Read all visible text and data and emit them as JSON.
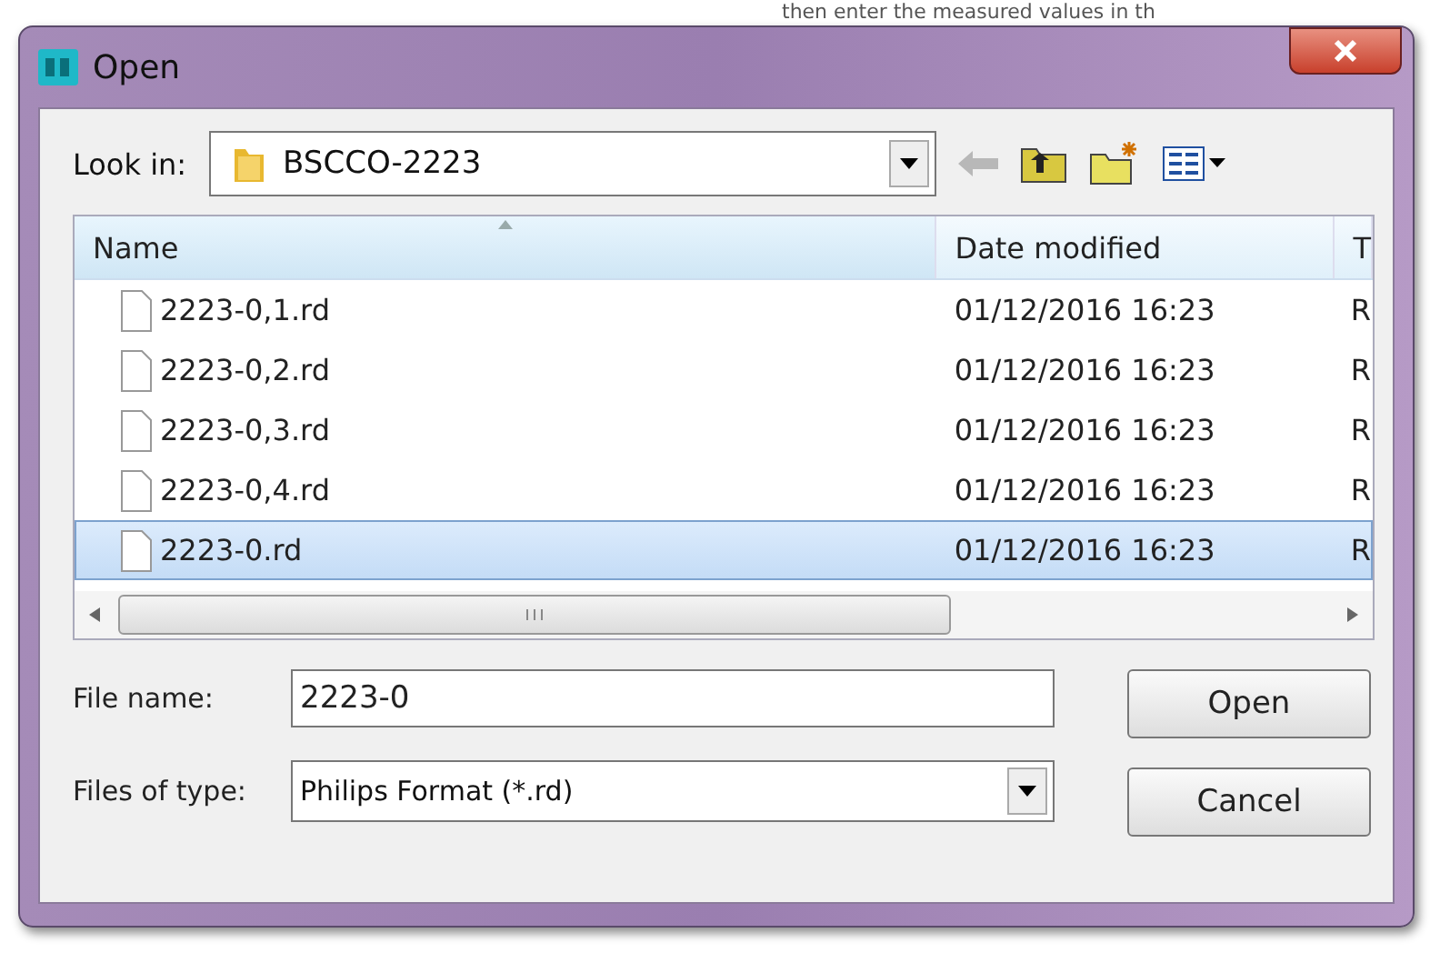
{
  "background_text": "then enter the measured values in th",
  "window": {
    "title": "Open"
  },
  "look_in": {
    "label": "Look in:",
    "value": "BSCCO-2223"
  },
  "columns": [
    {
      "label": "Name",
      "sorted": true
    },
    {
      "label": "Date modified",
      "sorted": false
    },
    {
      "label": "T",
      "sorted": false
    }
  ],
  "rows": [
    {
      "name": "2223-0,1.rd",
      "date": "01/12/2016 16:23",
      "column_3": "R",
      "selected": false
    },
    {
      "name": "2223-0,2.rd",
      "date": "01/12/2016 16:23",
      "column_3": "R",
      "selected": false
    },
    {
      "name": "2223-0,3.rd",
      "date": "01/12/2016 16:23",
      "column_3": "R",
      "selected": false
    },
    {
      "name": "2223-0,4.rd",
      "date": "01/12/2016 16:23",
      "column_3": "R",
      "selected": false
    },
    {
      "name": "2223-0.rd",
      "date": "01/12/2016 16:23",
      "column_3": "R",
      "selected": true
    }
  ],
  "file_name": {
    "label": "File name:",
    "value": "2223-0"
  },
  "file_type": {
    "label": "Files of type:",
    "value": "Philips Format (*.rd)"
  },
  "buttons": [
    "Open",
    "Cancel"
  ]
}
